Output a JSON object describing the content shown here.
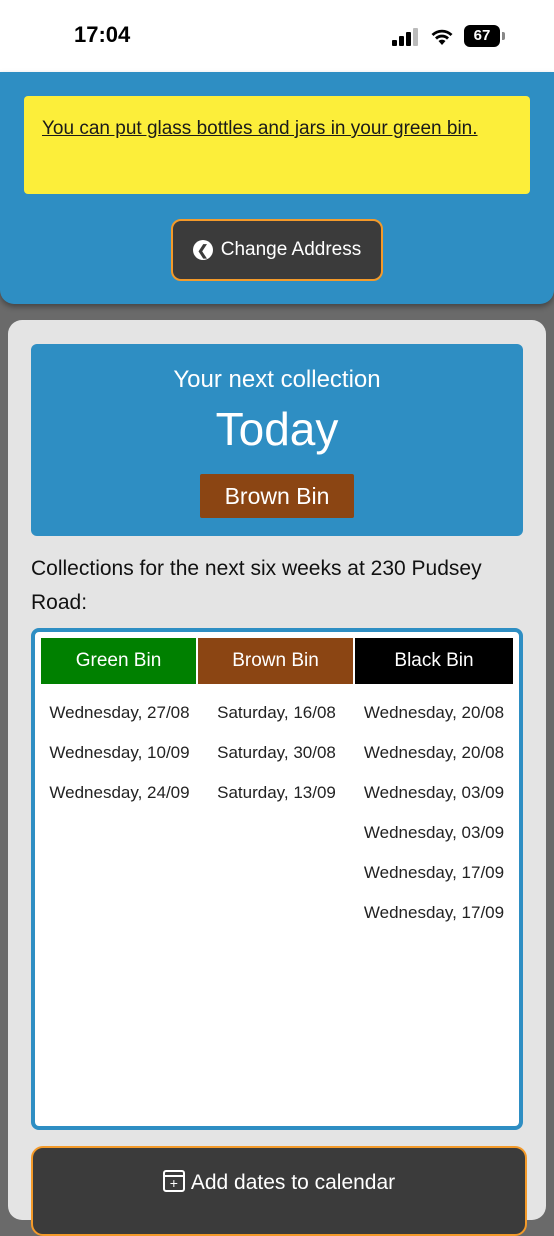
{
  "status_bar": {
    "time": "17:04",
    "battery": "67"
  },
  "notice": {
    "text": "You can put glass bottles and jars in your green bin."
  },
  "change_address": {
    "label": "Change Address"
  },
  "next_collection": {
    "label": "Your next collection",
    "date": "Today",
    "bin": "Brown Bin"
  },
  "six_weeks_heading": "Collections for the next six weeks at 230 Pudsey Road:",
  "colors": {
    "green": "#008000",
    "brown": "#8b4513",
    "black": "#000000",
    "accent": "#2e8ec3",
    "notice": "#fcee3a",
    "button_border": "#f39a2a"
  },
  "bins": [
    {
      "name": "Green Bin",
      "color": "#008000",
      "dates": [
        "Wednesday, 27/08",
        "Wednesday, 10/09",
        "Wednesday, 24/09"
      ]
    },
    {
      "name": "Brown Bin",
      "color": "#8b4513",
      "dates": [
        "Saturday, 16/08",
        "Saturday, 30/08",
        "Saturday, 13/09"
      ]
    },
    {
      "name": "Black Bin",
      "color": "#000000",
      "dates": [
        "Wednesday, 20/08",
        "Wednesday, 20/08",
        "Wednesday, 03/09",
        "Wednesday, 03/09",
        "Wednesday, 17/09",
        "Wednesday, 17/09"
      ]
    }
  ],
  "add_calendar": {
    "label": "Add dates to calendar"
  }
}
